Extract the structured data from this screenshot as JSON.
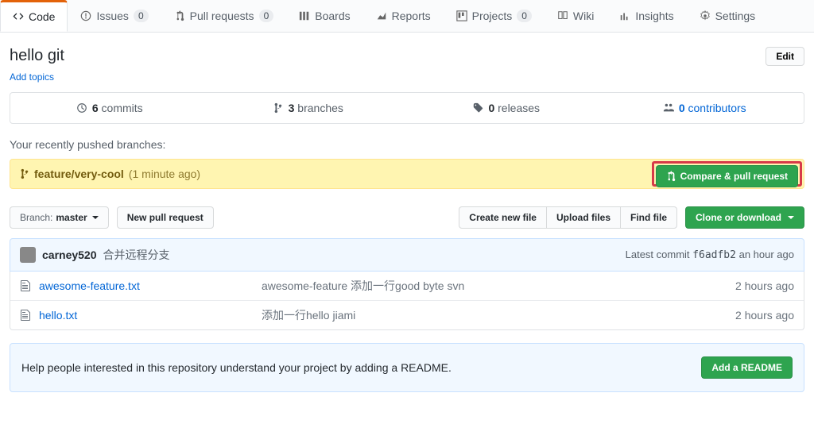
{
  "nav": {
    "tabs": [
      {
        "label": "Code",
        "icon": "code",
        "active": true
      },
      {
        "label": "Issues",
        "icon": "issue",
        "count": "0"
      },
      {
        "label": "Pull requests",
        "icon": "pr",
        "count": "0"
      },
      {
        "label": "Boards",
        "icon": "boards"
      },
      {
        "label": "Reports",
        "icon": "reports"
      },
      {
        "label": "Projects",
        "icon": "projects",
        "count": "0"
      },
      {
        "label": "Wiki",
        "icon": "wiki"
      },
      {
        "label": "Insights",
        "icon": "insights"
      },
      {
        "label": "Settings",
        "icon": "settings"
      }
    ]
  },
  "header": {
    "title": "hello git",
    "add_topics": "Add topics",
    "edit_label": "Edit"
  },
  "stats": {
    "commits": {
      "count": "6",
      "label": "commits"
    },
    "branches": {
      "count": "3",
      "label": "branches"
    },
    "releases": {
      "count": "0",
      "label": "releases"
    },
    "contributors": {
      "count": "0",
      "label": "contributors"
    }
  },
  "recent_push": {
    "label": "Your recently pushed branches:",
    "branch": "feature/very-cool",
    "time": "(1 minute ago)",
    "compare_label": "Compare & pull request"
  },
  "toolbar": {
    "branch_key": "Branch:",
    "branch_val": "master",
    "new_pr": "New pull request",
    "create_file": "Create new file",
    "upload": "Upload files",
    "find": "Find file",
    "clone": "Clone or download"
  },
  "commit": {
    "author": "carney520",
    "message": "合并远程分支",
    "latest_label": "Latest commit",
    "sha": "f6adfb2",
    "time": "an hour ago"
  },
  "files": [
    {
      "name": "awesome-feature.txt",
      "msg": "awesome-feature 添加一行good byte svn",
      "time": "2 hours ago"
    },
    {
      "name": "hello.txt",
      "msg": "添加一行hello jiami",
      "time": "2 hours ago"
    }
  ],
  "readme_banner": {
    "text": "Help people interested in this repository understand your project by adding a README.",
    "button": "Add a README"
  }
}
